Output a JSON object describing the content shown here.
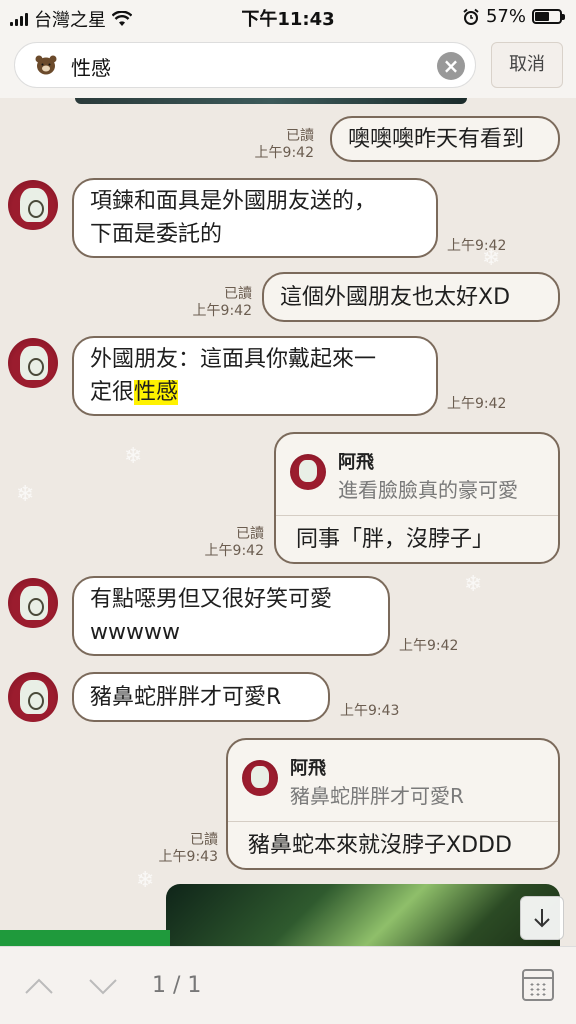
{
  "status_bar": {
    "carrier": "台灣之星",
    "time": "下午11:43",
    "battery": "57%",
    "battery_level": 0.57
  },
  "search": {
    "query": "性感",
    "cancel_label": "取消"
  },
  "messages": [
    {
      "dir": "out",
      "text": "噢噢噢昨天有看到",
      "read": "已讀",
      "time": "上午9:42"
    },
    {
      "dir": "in",
      "lines": [
        "項鍊和面具是外國朋友送的，",
        "下面是委託的"
      ],
      "time": "上午9:42"
    },
    {
      "dir": "out",
      "text": "這個外國朋友也太好XD",
      "read": "已讀",
      "time": "上午9:42"
    },
    {
      "dir": "in",
      "line1": "外國朋友：這面具你戴起來一",
      "line2_pre": "定很",
      "line2_hl": "性感",
      "time": "上午9:42"
    },
    {
      "dir": "out",
      "reply_name": "阿飛",
      "reply_quote": "進看臉臉真的豪可愛",
      "text": "同事「胖，沒脖子」",
      "read": "已讀",
      "time": "上午9:42"
    },
    {
      "dir": "in",
      "lines": [
        "有點噁男但又很好笑可愛",
        "wwwww"
      ],
      "time": "上午9:42"
    },
    {
      "dir": "in",
      "text": "豬鼻蛇胖胖才可愛R",
      "time": "上午9:43"
    },
    {
      "dir": "out",
      "reply_name": "阿飛",
      "reply_quote": "豬鼻蛇胖胖才可愛R",
      "text": "豬鼻蛇本來就沒脖子XDDD",
      "read": "已讀",
      "time": "上午9:43"
    }
  ],
  "bottom_bar": {
    "page_count": "1 / 1"
  }
}
